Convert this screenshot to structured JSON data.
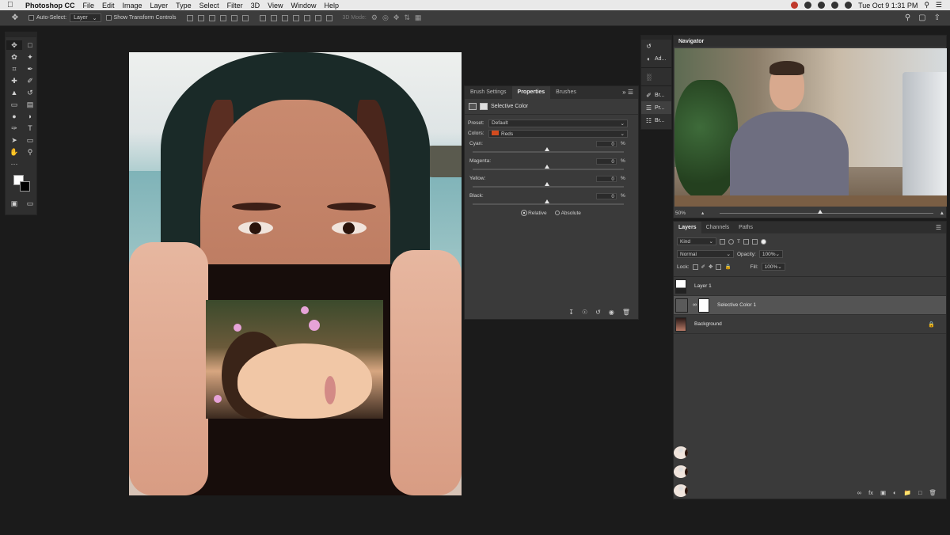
{
  "menubar": {
    "app_name": "Photoshop CC",
    "items": [
      "File",
      "Edit",
      "Image",
      "Layer",
      "Type",
      "Select",
      "Filter",
      "3D",
      "View",
      "Window",
      "Help"
    ],
    "clock": "Tue Oct 9  1:31 PM"
  },
  "optionsbar": {
    "auto_select_label": "Auto-Select:",
    "auto_select_value": "Layer",
    "transform_label": "Show Transform Controls",
    "mode_label": "3D Mode:"
  },
  "properties": {
    "tabs": [
      "Brush Settings",
      "Properties",
      "Brushes"
    ],
    "title": "Selective Color",
    "preset_label": "Preset:",
    "preset_value": "Default",
    "colors_label": "Colors:",
    "colors_value": "Reds",
    "sliders": [
      {
        "label": "Cyan:",
        "value": "0"
      },
      {
        "label": "Magenta:",
        "value": "0"
      },
      {
        "label": "Yellow:",
        "value": "0"
      },
      {
        "label": "Black:",
        "value": "0"
      }
    ],
    "percent": "%",
    "relative_label": "Relative",
    "absolute_label": "Absolute",
    "method": "Relative"
  },
  "strip": {
    "items": [
      "Ad...",
      "Br...",
      "Pr...",
      "Br..."
    ]
  },
  "navigator": {
    "title": "Navigator",
    "zoom": "50%"
  },
  "layers": {
    "tabs": [
      "Layers",
      "Channels",
      "Paths"
    ],
    "filter_value": "Kind",
    "blend_mode": "Normal",
    "opacity_label": "Opacity:",
    "opacity_value": "100%",
    "lock_label": "Lock:",
    "fill_label": "Fill:",
    "fill_value": "100%",
    "items": [
      {
        "name": "Layer 1"
      },
      {
        "name": "Selective Color 1"
      },
      {
        "name": "Background"
      }
    ]
  }
}
